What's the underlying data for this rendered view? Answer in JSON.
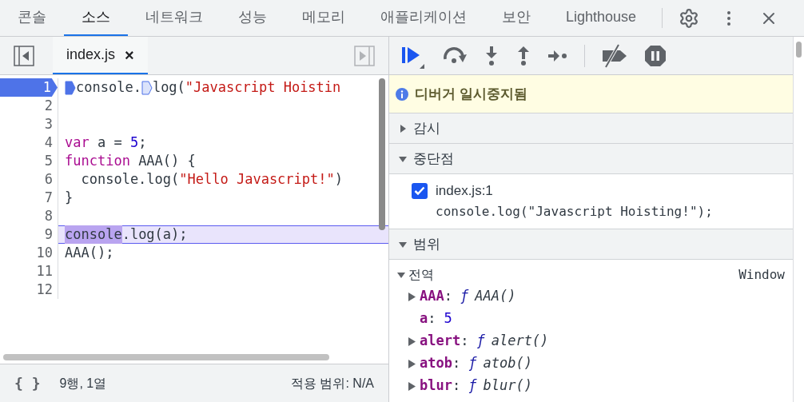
{
  "tabs": [
    {
      "label": "콘솔",
      "selected": false
    },
    {
      "label": "소스",
      "selected": true
    },
    {
      "label": "네트워크",
      "selected": false
    },
    {
      "label": "성능",
      "selected": false
    },
    {
      "label": "메모리",
      "selected": false
    },
    {
      "label": "애플리케이션",
      "selected": false
    },
    {
      "label": "보안",
      "selected": false
    },
    {
      "label": "Lighthouse",
      "selected": false
    }
  ],
  "editor": {
    "file_tab": {
      "label": "index.js",
      "close": "×",
      "selected": true
    },
    "lines": [
      {
        "number": "1",
        "kind": "code",
        "breakpoint": true,
        "tokens": [
          {
            "kind": "marker",
            "active": true
          },
          {
            "kind": "plain",
            "text": "console."
          },
          {
            "kind": "marker",
            "active": false
          },
          {
            "kind": "plain",
            "text": "log("
          },
          {
            "kind": "string",
            "text": "\"Javascript Hoistin"
          }
        ]
      },
      {
        "number": "2",
        "kind": "code",
        "breakpoint": false
      },
      {
        "number": "3",
        "kind": "code",
        "breakpoint": false
      },
      {
        "number": "4",
        "kind": "code",
        "breakpoint": false,
        "tokens": [
          {
            "kind": "keyword",
            "text": "var"
          },
          {
            "kind": "plain",
            "text": " a = "
          },
          {
            "kind": "number",
            "text": "5"
          },
          {
            "kind": "plain",
            "text": ";"
          }
        ]
      },
      {
        "number": "5",
        "kind": "code",
        "breakpoint": false,
        "tokens": [
          {
            "kind": "keyword",
            "text": "function"
          },
          {
            "kind": "plain",
            "text": " AAA() {"
          }
        ]
      },
      {
        "number": "6",
        "kind": "code",
        "breakpoint": false,
        "tokens": [
          {
            "kind": "plain",
            "text": "  console.log("
          },
          {
            "kind": "string",
            "text": "\"Hello Javascript!\""
          },
          {
            "kind": "plain",
            "text": ")"
          }
        ]
      },
      {
        "number": "7",
        "kind": "code",
        "breakpoint": false,
        "tokens": [
          {
            "kind": "plain",
            "text": "}"
          }
        ]
      },
      {
        "number": "8",
        "kind": "code",
        "breakpoint": false
      },
      {
        "number": "9",
        "kind": "paused",
        "breakpoint": false,
        "tokens": [
          {
            "kind": "exec",
            "text": "console"
          },
          {
            "kind": "plain",
            "text": ".log(a);"
          }
        ]
      },
      {
        "number": "10",
        "kind": "code",
        "breakpoint": false,
        "tokens": [
          {
            "kind": "plain",
            "text": "AAA();"
          }
        ]
      },
      {
        "number": "11",
        "kind": "code",
        "breakpoint": false
      },
      {
        "number": "12",
        "kind": "code",
        "breakpoint": false
      }
    ]
  },
  "status_bar": {
    "format": "{ }",
    "position": "9행, 1열",
    "coverage": "적용 범위: N/A"
  },
  "debugger": {
    "paused_message": "디버거 일시중지됨",
    "watch": {
      "title": "감시",
      "expanded": false
    },
    "breakpoints": {
      "title": "중단점",
      "expanded": true,
      "items": [
        {
          "location": "index.js:1",
          "code": "console.log(\"Javascript Hoisting!\");",
          "checked": true
        }
      ]
    },
    "scope": {
      "title": "범위",
      "expanded": true,
      "groups": [
        {
          "title": "전역",
          "expanded": true,
          "value": "Window",
          "properties": [
            {
              "name": "AAA",
              "separator": ":",
              "kind": "function",
              "mark": "ƒ",
              "value": "AAA()"
            },
            {
              "name": "a",
              "separator": ":",
              "kind": "number",
              "value": "5"
            },
            {
              "name": "alert",
              "separator": ":",
              "kind": "function",
              "mark": "ƒ",
              "value": "alert()"
            },
            {
              "name": "atob",
              "separator": ":",
              "kind": "function",
              "mark": "ƒ",
              "value": "atob()"
            },
            {
              "name": "blur",
              "separator": ":",
              "kind": "function",
              "mark": "ƒ",
              "value": "blur()"
            }
          ]
        }
      ]
    }
  }
}
